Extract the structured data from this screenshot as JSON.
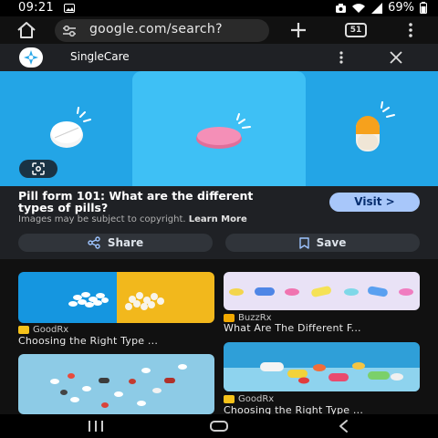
{
  "status": {
    "time": "09:21",
    "battery": "69%",
    "icons": [
      "image-notification-icon",
      "camera-indicator-icon",
      "wifi-icon",
      "signal-icon",
      "battery-icon"
    ]
  },
  "browser": {
    "url": "google.com/search?",
    "tab_count": "51",
    "icons": [
      "home-icon",
      "tune-icon",
      "plus-icon",
      "tabs-icon",
      "more-vert-icon"
    ]
  },
  "sheet": {
    "source_name": "SingleCare",
    "title": "Pill form 101: What are the different types of pills?",
    "visit_label": "Visit",
    "visit_arrow": ">",
    "copyright_text": "Images may be subject to copyright.",
    "learn_more": "Learn More",
    "share_label": "Share",
    "save_label": "Save"
  },
  "related": [
    {
      "source": "GoodRx",
      "title": "Choosing the Right Type ...",
      "fav_color": "#f6c21a"
    },
    {
      "source": "BuzzRx",
      "title": "What Are The Different F...",
      "fav_color": "#f2a900"
    },
    {
      "source": "",
      "title": "",
      "fav_color": ""
    },
    {
      "source": "GoodRx",
      "title": "Choosing the Right Type ...",
      "fav_color": "#f6c21a"
    }
  ],
  "colors": {
    "hero_blue": "#23a5e6",
    "hero_light": "#3ec0f5",
    "visit_bg": "#a8c7fa",
    "panel_bg": "#1f2125"
  }
}
